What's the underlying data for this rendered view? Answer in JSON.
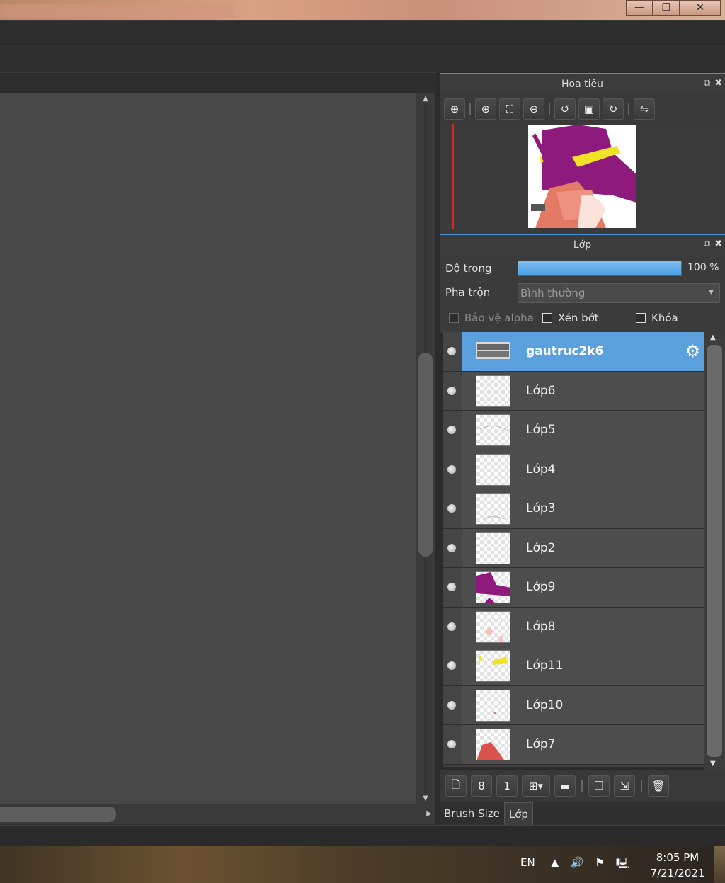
{
  "window": {
    "controls": [
      "minimize",
      "restore",
      "close"
    ]
  },
  "navigator": {
    "title": "Hoa tiêu",
    "tools": [
      "zoom-actual-icon",
      "zoom-in-icon",
      "fit-screen-icon",
      "zoom-out-icon",
      "rotate-left-icon",
      "fit-window-icon",
      "rotate-right-icon",
      "flip-icon"
    ]
  },
  "layers_panel": {
    "title": "Lớp",
    "opacity_label": "Độ trong",
    "opacity_value": "100 %",
    "blend_label": "Pha trộn",
    "blend_value": "Bình thường",
    "protect_alpha": "Bảo vệ alpha",
    "clipping": "Xén bớt",
    "lock": "Khóa",
    "layers": [
      {
        "name": "gautruc2k6",
        "selected": true
      },
      {
        "name": "Lớp6"
      },
      {
        "name": "Lớp5"
      },
      {
        "name": "Lớp4"
      },
      {
        "name": "Lớp3"
      },
      {
        "name": "Lớp2"
      },
      {
        "name": "Lớp9"
      },
      {
        "name": "Lớp8"
      },
      {
        "name": "Lớp11"
      },
      {
        "name": "Lớp10"
      },
      {
        "name": "Lớp7"
      }
    ]
  },
  "bottom_tabs": {
    "brush_size": "Brush Size",
    "layer": "Lớp"
  },
  "taskbar": {
    "lang": "EN",
    "time": "8:05 PM",
    "date": "7/21/2021"
  },
  "colors": {
    "accent": "#4a90d9",
    "selected_layer": "#5aa0dc",
    "canvas": "#474747"
  }
}
